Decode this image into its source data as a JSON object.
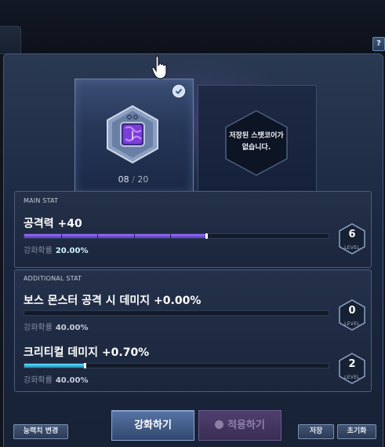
{
  "help_label": "?",
  "core": {
    "count_current": "08",
    "count_separator": "/",
    "count_max": "20"
  },
  "saved_core_message": [
    "저장된 스탯코어가",
    "없습니다."
  ],
  "main_stat": {
    "section_label": "MAIN STAT",
    "name": "공격력 +40",
    "rate_label": "강화확률",
    "rate_value": "20.00%",
    "level": "6",
    "level_word": "LEVEL",
    "progress": 0.6
  },
  "additional_stat": {
    "section_label": "ADDITIONAL STAT",
    "items": [
      {
        "name": "보스 몬스터 공격 시 데미지 +0.00%",
        "rate_label": "강화확률",
        "rate_value": "40.00%",
        "level": "0",
        "level_word": "LEVEL",
        "progress": 0.0
      },
      {
        "name": "크리티컬 데미지 +0.70%",
        "rate_label": "강화확률",
        "rate_value": "40.00%",
        "level": "2",
        "level_word": "LEVEL",
        "progress": 0.2
      }
    ]
  },
  "buttons": {
    "change_ability": "능력치 변경",
    "enhance": "강화하기",
    "apply": "적용하기",
    "save": "저장",
    "reset": "초기화"
  },
  "colors": {
    "progress_main": "#8a63f2",
    "progress_additional": "#3dc4ef",
    "accent": "#6e8cc4"
  }
}
